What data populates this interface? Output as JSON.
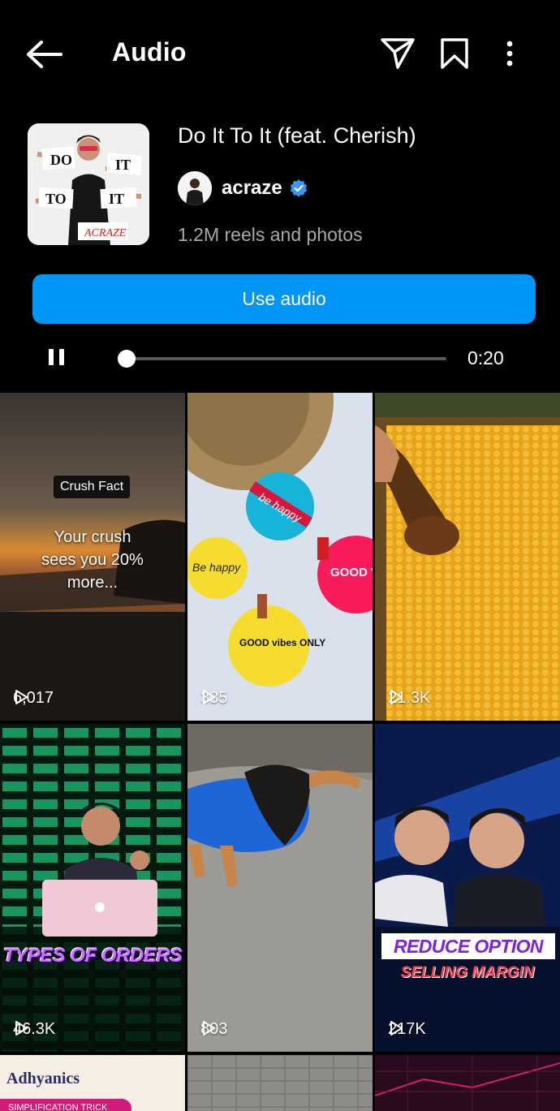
{
  "header": {
    "title": "Audio",
    "back_icon": "arrow-left-icon",
    "share_icon": "send-icon",
    "save_icon": "bookmark-icon",
    "more_icon": "more-vertical-icon"
  },
  "audio": {
    "song_title": "Do It To It (feat. Cherish)",
    "artist": "acraze",
    "verified": true,
    "reel_count": "1.2M reels and photos",
    "cover_lettering": [
      "DO",
      "IT",
      "TO",
      "IT",
      "ACRAZE"
    ]
  },
  "actions": {
    "use_audio_label": "Use audio"
  },
  "player": {
    "state": "playing",
    "progress": 0.02,
    "time": "0:20"
  },
  "accent_color": "#0095f6",
  "grid": {
    "tiles": [
      {
        "views": "6,017",
        "badge": "Crush Fact",
        "caption_lines": [
          "Your crush",
          "sees you 20%",
          "more..."
        ]
      },
      {
        "views": "335",
        "image_text": [
          "be happy",
          "Be happy",
          "GOOD vibes ONLY",
          "GOOD VIB"
        ]
      },
      {
        "views": "21.3K"
      },
      {
        "views": "46.3K",
        "overlay_text": "TYPES OF ORDERS"
      },
      {
        "views": "803"
      },
      {
        "views": "217K",
        "overlay_title": "REDUCE OPTION",
        "overlay_subtitle": "SELLING MARGIN"
      },
      {
        "logo": "Adhyanics",
        "pill": "SIMPLIFICATION TRICK"
      },
      {},
      {}
    ]
  }
}
